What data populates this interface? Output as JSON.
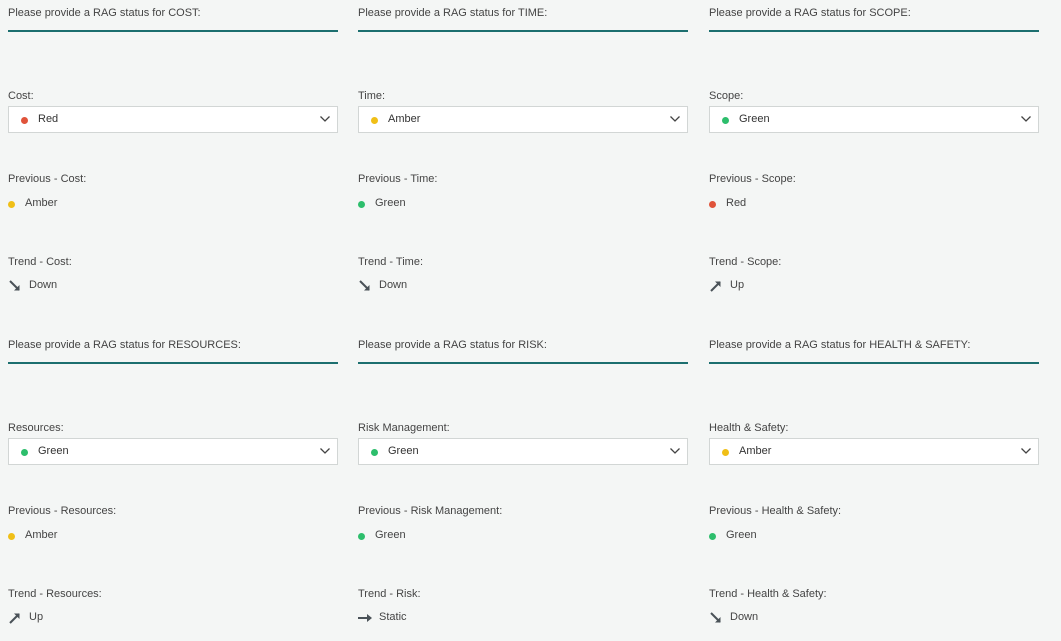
{
  "colors": {
    "red": "#e0533a",
    "amber": "#f0bf17",
    "green": "#2dbe6c",
    "rule": "#1c6f6f"
  },
  "sections": [
    {
      "heading": "Please provide a RAG status for COST:",
      "current_label": "Cost:",
      "current_value": "Red",
      "current_color": "#e0533a",
      "previous_label": "Previous - Cost:",
      "previous_value": "Amber",
      "previous_color": "#f0bf17",
      "trend_label": "Trend - Cost:",
      "trend_value": "Down",
      "trend_icon": "arrow-down-right-icon"
    },
    {
      "heading": "Please provide a RAG status for TIME:",
      "current_label": "Time:",
      "current_value": "Amber",
      "current_color": "#f0bf17",
      "previous_label": "Previous - Time:",
      "previous_value": "Green",
      "previous_color": "#2dbe6c",
      "trend_label": "Trend - Time:",
      "trend_value": "Down",
      "trend_icon": "arrow-down-right-icon"
    },
    {
      "heading": "Please provide a RAG status for SCOPE:",
      "current_label": "Scope:",
      "current_value": "Green",
      "current_color": "#2dbe6c",
      "previous_label": "Previous - Scope:",
      "previous_value": "Red",
      "previous_color": "#e0533a",
      "trend_label": "Trend - Scope:",
      "trend_value": "Up",
      "trend_icon": "arrow-up-right-icon"
    },
    {
      "heading": "Please provide a RAG status for RESOURCES:",
      "current_label": "Resources:",
      "current_value": "Green",
      "current_color": "#2dbe6c",
      "previous_label": "Previous - Resources:",
      "previous_value": "Amber",
      "previous_color": "#f0bf17",
      "trend_label": "Trend - Resources:",
      "trend_value": "Up",
      "trend_icon": "arrow-up-right-icon"
    },
    {
      "heading": "Please provide a RAG status for RISK:",
      "current_label": "Risk Management:",
      "current_value": "Green",
      "current_color": "#2dbe6c",
      "previous_label": "Previous - Risk Management:",
      "previous_value": "Green",
      "previous_color": "#2dbe6c",
      "trend_label": "Trend - Risk:",
      "trend_value": "Static",
      "trend_icon": "arrow-right-icon"
    },
    {
      "heading": "Please provide a RAG status for HEALTH & SAFETY:",
      "current_label": "Health & Safety:",
      "current_value": "Amber",
      "current_color": "#f0bf17",
      "previous_label": "Previous - Health & Safety:",
      "previous_value": "Green",
      "previous_color": "#2dbe6c",
      "trend_label": "Trend - Health & Safety:",
      "trend_value": "Down",
      "trend_icon": "arrow-down-right-icon"
    }
  ]
}
